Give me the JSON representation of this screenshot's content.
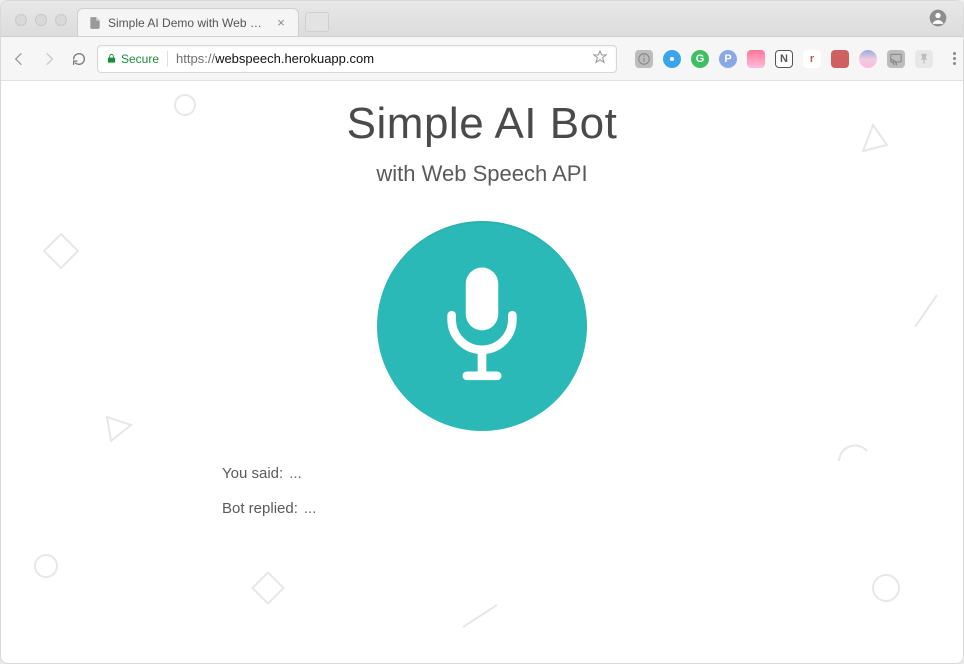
{
  "browser": {
    "tab_title": "Simple AI Demo with Web Spe…",
    "secure_label": "Secure",
    "url_protocol": "https://",
    "url_host": "webspeech.herokuapp.com",
    "extension_labels": {
      "info": "i",
      "loom": "",
      "grammarly": "G",
      "purple": "P",
      "pic": "",
      "notion": "N",
      "r": "r",
      "red": "",
      "rainbow": "",
      "cast": "",
      "pin": ""
    }
  },
  "page": {
    "title": "Simple AI Bot",
    "subtitle": "with Web Speech API",
    "mic_color": "#2bb9b8",
    "you_said_label": "You said:",
    "you_said_value": "...",
    "bot_replied_label": "Bot replied:",
    "bot_replied_value": "..."
  }
}
